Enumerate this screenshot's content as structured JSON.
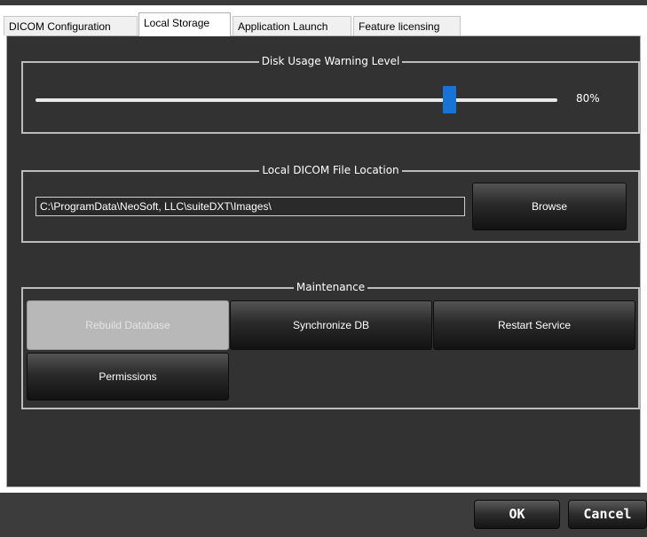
{
  "tabs": [
    {
      "label": "DICOM Configuration",
      "active": false
    },
    {
      "label": "Local Storage",
      "active": true
    },
    {
      "label": "Application Launch",
      "active": false
    },
    {
      "label": "Feature licensing",
      "active": false
    }
  ],
  "disk_usage": {
    "title": "Disk Usage Warning Level",
    "value_label": "80%",
    "value_fraction": 0.8
  },
  "file_location": {
    "title": "Local DICOM File Location",
    "path": "C:\\ProgramData\\NeoSoft, LLC\\suiteDXT\\Images\\",
    "browse_label": "Browse"
  },
  "maintenance": {
    "title": "Maintenance",
    "rebuild_label": "Rebuild Database",
    "rebuild_enabled": false,
    "sync_label": "Synchronize DB",
    "restart_label": "Restart Service",
    "permissions_label": "Permissions"
  },
  "dialog": {
    "ok_label": "OK",
    "cancel_label": "Cancel"
  },
  "colors": {
    "panel_bg": "#323232",
    "accent": "#1873d6",
    "disabled_button": "#b8b8b8"
  }
}
